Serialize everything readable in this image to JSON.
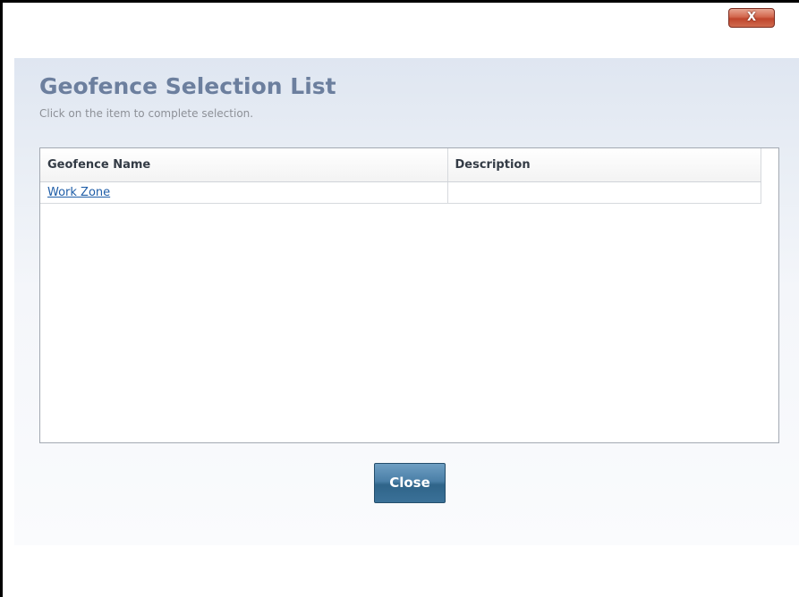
{
  "window": {
    "close_glyph": "X"
  },
  "dialog": {
    "title": "Geofence Selection List",
    "subtitle": "Click on the item to complete selection.",
    "columns": [
      "Geofence Name",
      "Description"
    ],
    "rows": [
      {
        "name": "Work Zone",
        "description": ""
      }
    ],
    "close_button_label": "Close"
  },
  "colors": {
    "title": "#6c7f9e",
    "link": "#1f5ea8",
    "close_button": "#3b7198",
    "window_close_button": "#c0452c"
  }
}
